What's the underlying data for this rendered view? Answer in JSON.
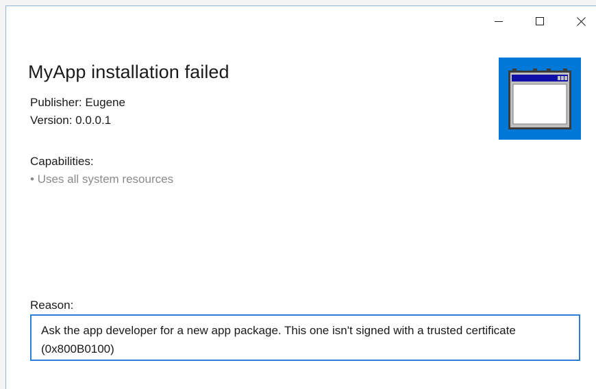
{
  "window": {
    "title_bar_buttons": {
      "minimize_icon": "minimize-icon",
      "maximize_icon": "maximize-icon",
      "close_icon": "close-icon"
    }
  },
  "app": {
    "title": "MyApp installation failed",
    "publisher": "Publisher: Eugene",
    "version": "Version: 0.0.0.1",
    "logo_icon": "app-window-icon",
    "logo_background": "#0078d7"
  },
  "capabilities": {
    "heading": "Capabilities:",
    "items": [
      "• Uses all system resources"
    ]
  },
  "reason": {
    "label": "Reason:",
    "text": "Ask the app developer for a new app package. This one isn't signed with a trusted certificate (0x800B0100)"
  },
  "colors": {
    "accent": "#0078d7",
    "border": "#2a7fd4",
    "muted_text": "#8a8a8a"
  }
}
